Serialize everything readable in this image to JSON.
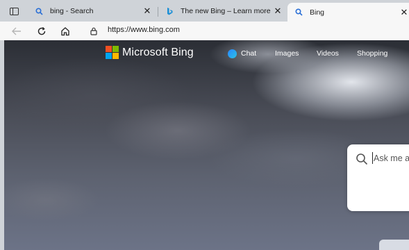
{
  "tabs": [
    {
      "title": "bing - Search",
      "favicon": "search-icon",
      "active": false
    },
    {
      "title": "The new Bing – Learn more",
      "favicon": "bing-b-icon",
      "active": false
    },
    {
      "title": "Bing",
      "favicon": "search-icon",
      "active": true
    }
  ],
  "tab_close_glyph": "✕",
  "address": {
    "url": "https://www.bing.com"
  },
  "page": {
    "logo_text": "Microsoft Bing",
    "nav": {
      "chat": "Chat",
      "images": "Images",
      "videos": "Videos",
      "shopping": "Shopping"
    },
    "search_placeholder": "Ask me an"
  },
  "colors": {
    "ms_red": "#f25022",
    "ms_green": "#7fba00",
    "ms_blue": "#00a4ef",
    "ms_yellow": "#ffb900"
  }
}
